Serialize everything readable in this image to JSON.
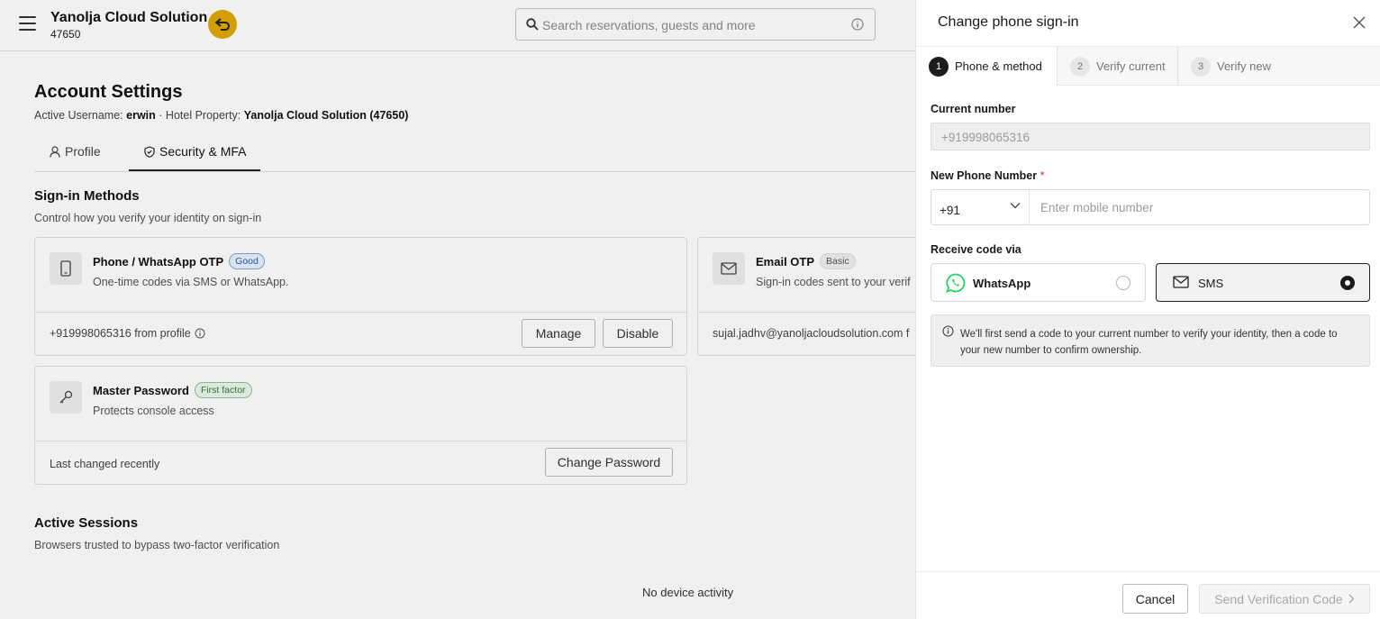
{
  "header": {
    "brand_name": "Yanolja Cloud Solution",
    "brand_id": "47650",
    "search_placeholder": "Search reservations, guests and more"
  },
  "account": {
    "title": "Account Settings",
    "username_label": "Active Username:",
    "username": "erwin",
    "property_label": "· Hotel Property:",
    "property": "Yanolja Cloud Solution (47650)"
  },
  "tabs": [
    {
      "label": "Profile",
      "active": false
    },
    {
      "label": "Security & MFA",
      "active": true
    }
  ],
  "signin": {
    "title": "Sign-in Methods",
    "subtitle": "Control how you verify your identity on sign-in",
    "phone": {
      "title": "Phone / WhatsApp OTP",
      "badge": "Good",
      "desc": "One-time codes via SMS or WhatsApp.",
      "footer": "+919998065316 from profile",
      "manage": "Manage",
      "disable": "Disable"
    },
    "email": {
      "title": "Email OTP",
      "badge": "Basic",
      "desc": "Sign-in codes sent to your verif",
      "footer": "sujal.jadhv@yanoljacloudsolution.com f"
    },
    "password": {
      "title": "Master Password",
      "badge": "First factor",
      "desc": "Protects console access",
      "footer": "Last changed recently",
      "change": "Change Password"
    }
  },
  "sessions": {
    "title": "Active Sessions",
    "subtitle": "Browsers trusted to bypass two-factor verification",
    "empty": "No device activity"
  },
  "drawer": {
    "title": "Change phone sign-in",
    "steps": [
      {
        "num": "1",
        "label": "Phone & method",
        "active": true
      },
      {
        "num": "2",
        "label": "Verify current",
        "active": false
      },
      {
        "num": "3",
        "label": "Verify new",
        "active": false
      }
    ],
    "current_label": "Current number",
    "current_value": "+919998065316",
    "new_label": "New Phone Number",
    "required_mark": "*",
    "country_code": "+91",
    "mobile_placeholder": "Enter mobile number",
    "receive_label": "Receive code via",
    "options": [
      {
        "label": "WhatsApp",
        "selected": false
      },
      {
        "label": "SMS",
        "selected": true
      }
    ],
    "note": "We'll first send a code to your current number to verify your identity, then a code to your new number to confirm ownership.",
    "cancel": "Cancel",
    "send": "Send Verification Code",
    "colors": {
      "whatsapp": "#25D366",
      "badge_bg": "#e0a800",
      "required": "#d32f2f"
    }
  }
}
